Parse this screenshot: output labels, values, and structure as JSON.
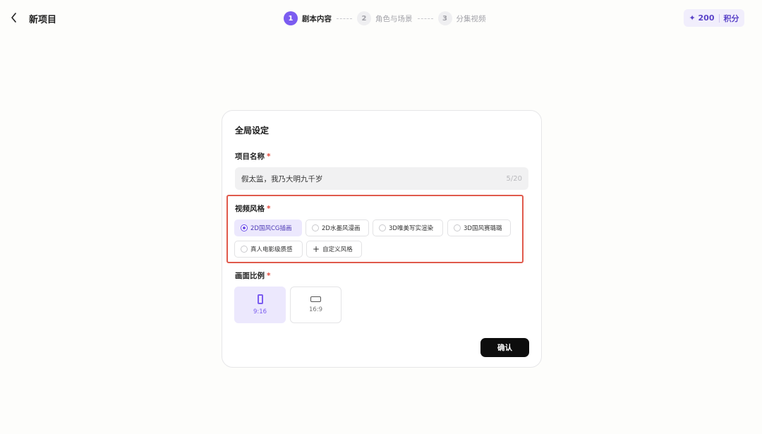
{
  "header": {
    "title": "新项目",
    "steps": [
      {
        "num": "1",
        "label": "剧本内容"
      },
      {
        "num": "2",
        "label": "角色与场景"
      },
      {
        "num": "3",
        "label": "分集视频"
      }
    ],
    "points": {
      "value": "✦ 200",
      "label": "积分"
    }
  },
  "card": {
    "title": "全局设定",
    "project_name": {
      "label": "项目名称",
      "required": "*",
      "value": "假太监，我乃大明九千岁",
      "counter": "5/20"
    },
    "style": {
      "label": "视频风格",
      "required": "*",
      "options": [
        "2D国风CG插画",
        "2D水墨风漫画",
        "3D唯美写实渲染",
        "3D国风赛璐璐",
        "真人电影级质感"
      ],
      "selected": "2D国风CG插画",
      "custom_label": "自定义风格"
    },
    "ratio": {
      "label": "画面比例",
      "required": "*",
      "options": [
        "9:16",
        "16:9"
      ],
      "selected": "9:16"
    },
    "confirm_label": "确认"
  },
  "colors": {
    "accent": "#7b5cf0",
    "accent_bg": "#ece8fd",
    "required": "#e3473a",
    "highlight_border": "#e05a4c",
    "button_bg": "#0d0d0d"
  }
}
